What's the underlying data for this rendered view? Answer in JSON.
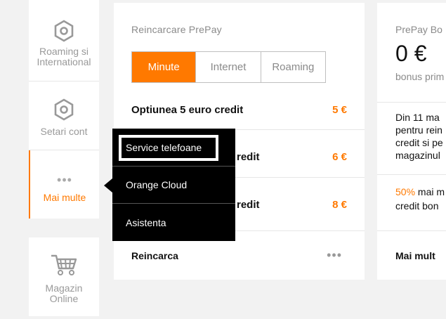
{
  "sidebar": {
    "items": [
      {
        "label_1": "Roaming si",
        "label_2": "International",
        "icon": "hexagon-icon"
      },
      {
        "label": "Setari cont",
        "icon": "hexagon-icon"
      },
      {
        "label": "Mai multe",
        "icon": "more-dots-icon",
        "dots": "•••"
      },
      {
        "label_1": "Magazin",
        "label_2": "Online",
        "icon": "cart-icon"
      }
    ]
  },
  "prepay_card": {
    "title": "Reincarcare PrePay",
    "tabs": [
      "Minute",
      "Internet",
      "Roaming"
    ],
    "options": [
      {
        "name": "Optiunea 5 euro credit",
        "price": "5 €"
      },
      {
        "name": "redit",
        "price": "6 €"
      },
      {
        "name": "redit",
        "price": "8 €"
      }
    ],
    "footer": "Reincarca",
    "footer_dots": "•••"
  },
  "bonus_card": {
    "title": "PrePay Bo",
    "amount": "0 €",
    "subtitle": "bonus prim",
    "text_lines": [
      "Din 11 ma",
      "pentru rein",
      "credit si pe",
      "magazinul"
    ],
    "percent": "50%",
    "percent_rest": " mai m",
    "line_after": "credit bon",
    "footer": "Mai mult"
  },
  "dropdown": {
    "items": [
      "Service telefoane",
      "Orange Cloud",
      "Asistenta"
    ]
  },
  "colors": {
    "accent": "#ff7900",
    "menu_bg": "#000000",
    "card_bg": "#ffffff",
    "page_bg": "#f2f2f2"
  }
}
